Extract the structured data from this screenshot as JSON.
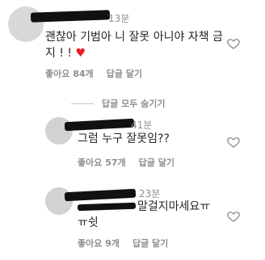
{
  "comments": [
    {
      "time": "13분",
      "text_line1": "괜찮아 기범아 니 잘못 아니야 자책 금",
      "text_line2": "지 ! !",
      "emoji": "♥",
      "likes": "좋아요 84개",
      "reply": "답글 달기"
    }
  ],
  "toggle_label": "답글 모두 숨기기",
  "replies": [
    {
      "time": "41분",
      "text": "그럼 누구 잘못임??",
      "likes": "좋아요 57개",
      "reply": "답글 달기"
    },
    {
      "time": "23분",
      "text_line1": "말걸지마세요ㅠ",
      "text_line2": "ㅠ쉿",
      "likes": "좋아요 9개",
      "reply": "답글 달기"
    }
  ],
  "colors": {
    "text": "#262626",
    "muted": "#8e8e8e",
    "heart_red": "#ed1c24"
  },
  "icons": [
    "heart-outline-icon"
  ]
}
